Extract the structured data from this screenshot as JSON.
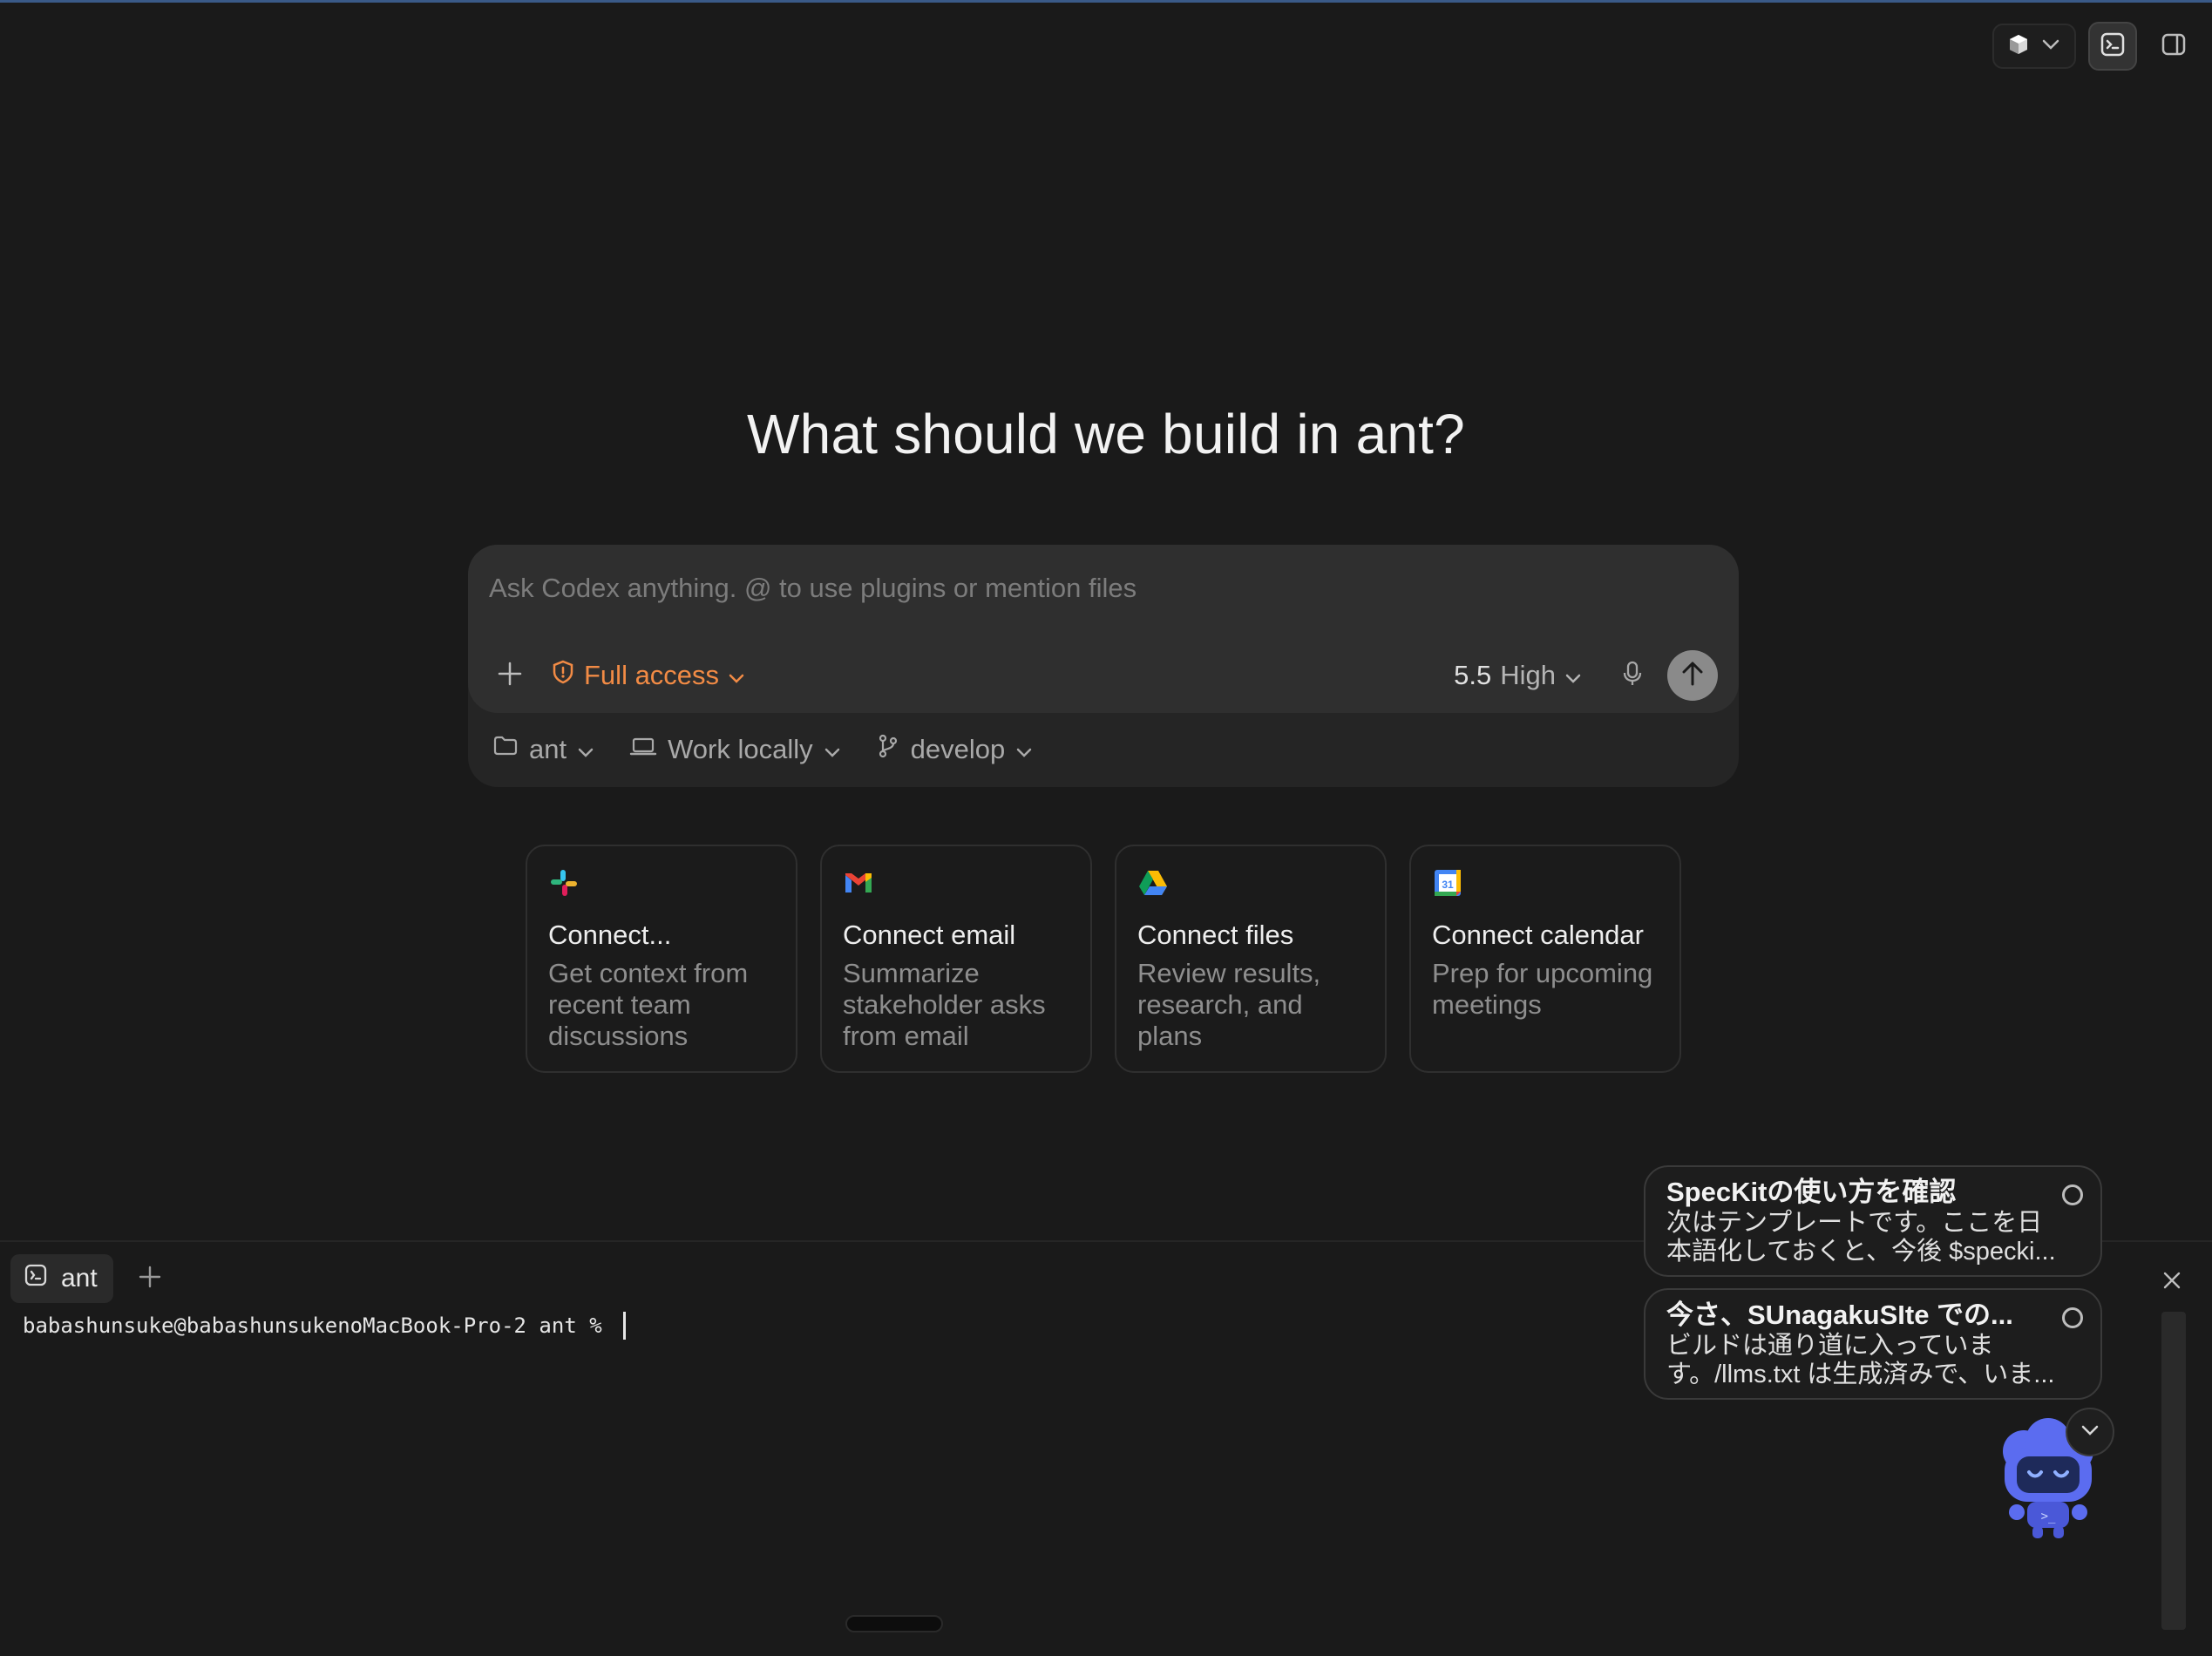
{
  "hero": {
    "title": "What should we build in ant?"
  },
  "composer": {
    "placeholder": "Ask Codex anything. @ to use plugins or mention files",
    "access_label": "Full access",
    "model_version": "5.5",
    "model_effort": "High",
    "project_label": "ant",
    "location_label": "Work locally",
    "branch_label": "develop"
  },
  "cards": [
    {
      "icon": "slack-icon",
      "title": "Connect...",
      "desc": "Get context from recent team discussions"
    },
    {
      "icon": "gmail-icon",
      "title": "Connect email",
      "desc": "Summarize stakeholder asks from email"
    },
    {
      "icon": "drive-icon",
      "title": "Connect files",
      "desc": "Review results, research, and plans"
    },
    {
      "icon": "calendar-icon",
      "title": "Connect calendar",
      "desc": "Prep for upcoming meetings",
      "calendar_day": "31"
    }
  ],
  "terminal": {
    "tab_label": "ant",
    "prompt": "babashunsuke@babashunsukenoMacBook-Pro-2 ant % "
  },
  "notifications": [
    {
      "title": "SpecKitの使い方を確認",
      "body": "次はテンプレートです。ここを日本語化しておくと、今後 $specki..."
    },
    {
      "title": "今さ、SUnagakuSIte での...",
      "body": "ビルドは通り道に入っています。/llms.txt は生成済みで、いま..."
    }
  ],
  "mascot": {
    "screen_glyph": ">_"
  },
  "colors": {
    "accent_orange": "#f28b45",
    "background": "#1a1a1a",
    "mascot_blue": "#5b6cf0"
  }
}
